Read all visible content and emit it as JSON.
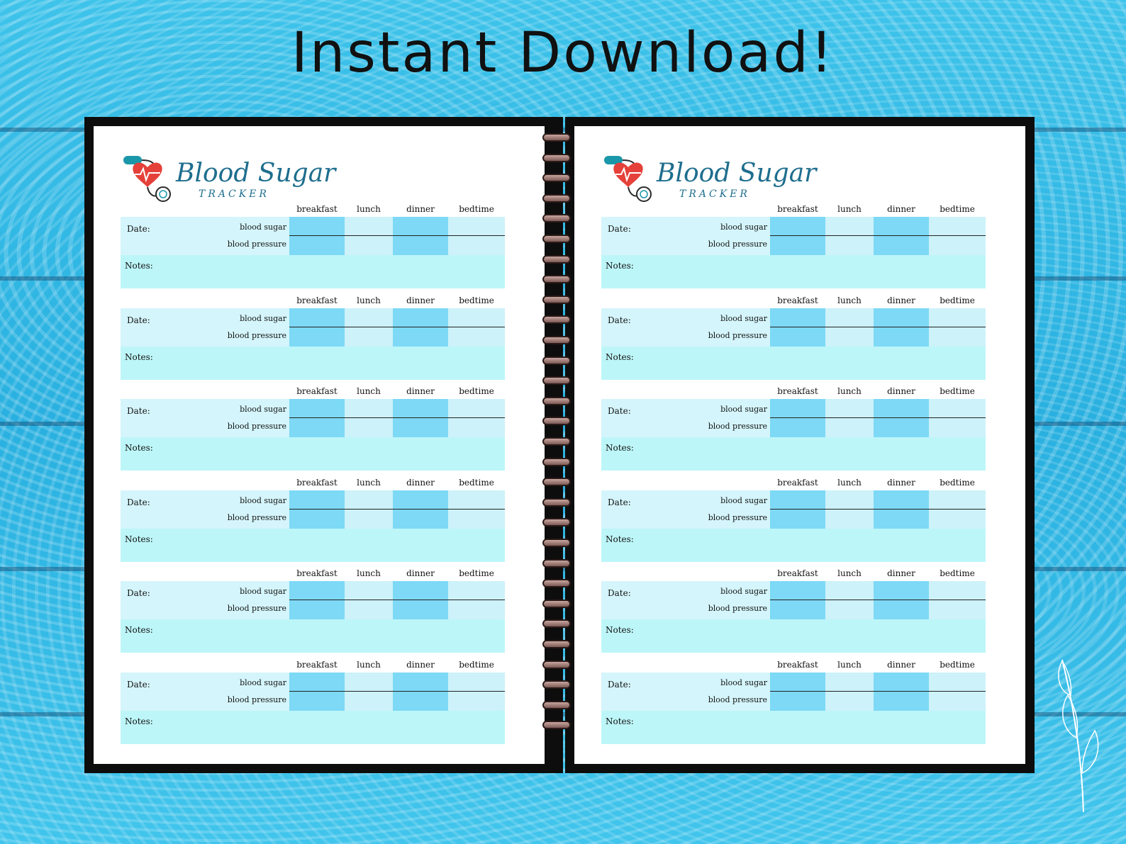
{
  "headline": "Instant Download!",
  "tracker": {
    "title": "Blood Sugar",
    "subtitle": "TRACKER",
    "meals": [
      "breakfast",
      "lunch",
      "dinner",
      "bedtime"
    ],
    "date_label": "Date:",
    "row1_label": "blood sugar",
    "row2_label": "blood pressure",
    "notes_label": "Notes:"
  },
  "pages": [
    {
      "side": "left",
      "entries": 6
    },
    {
      "side": "right",
      "entries": 6
    }
  ],
  "colors": {
    "background": "#2fb6e3",
    "column_dark": "#7dd9f6",
    "column_light": "#cdf2f9",
    "notes": "#bdf6f8",
    "logo_text": "#1e6e8e",
    "binding": "#0d0d0d"
  },
  "icons": [
    "stethoscope-heart-icon",
    "leaf-icon"
  ]
}
